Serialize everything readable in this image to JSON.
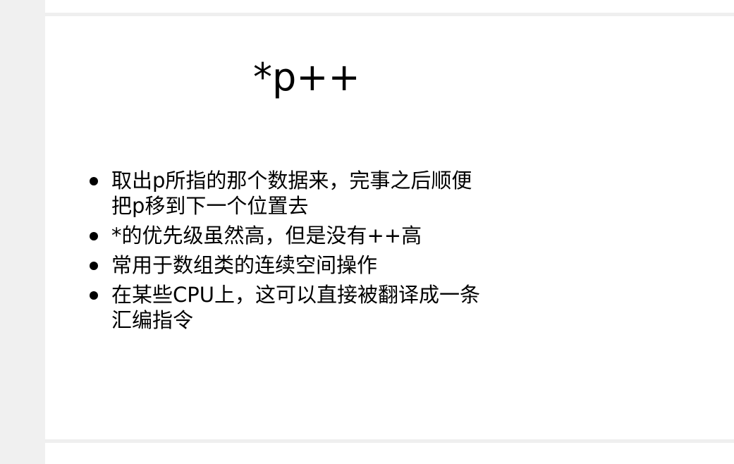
{
  "slide": {
    "title": "*p++",
    "bullets": [
      {
        "line1": "取出p所指的那个数据来，完事之后顺便",
        "line2": "把p移到下一个位置去"
      },
      {
        "line1": "*的优先级虽然高，但是没有++高",
        "line2": ""
      },
      {
        "line1": "常用于数组类的连续空间操作",
        "line2": ""
      },
      {
        "line1": "在某些CPU上，这可以直接被翻译成一条",
        "line2": "汇编指令"
      }
    ]
  }
}
